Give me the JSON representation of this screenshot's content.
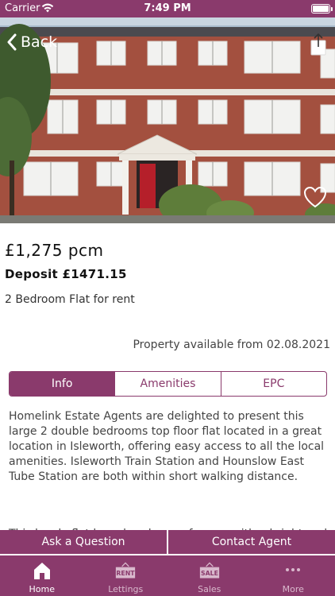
{
  "status_bar": {
    "carrier": "Carrier",
    "time": "7:49 PM"
  },
  "header": {
    "back_label": "Back"
  },
  "listing": {
    "price": "£1,275 pcm",
    "deposit": "Deposit £1471.15",
    "property_type": "2 Bedroom Flat for rent",
    "availability": "Property available from 02.08.2021"
  },
  "tabs": [
    {
      "label": "Info",
      "active": true
    },
    {
      "label": "Amenities",
      "active": false
    },
    {
      "label": "EPC",
      "active": false
    }
  ],
  "description": {
    "paragraph1": "Homelink Estate Agents are delighted to present this large 2 double bedrooms top floor flat located in a great location in Isleworth, offering easy access to all the local amenities. Isleworth Train Station and Hounslow East Tube Station are both within short walking distance.",
    "paragraph2": "This lovely flat has abundance of space with a bright and"
  },
  "actions": {
    "ask_question": "Ask a Question",
    "contact_agent": "Contact Agent"
  },
  "tab_bar": [
    {
      "label": "Home",
      "icon": "home-icon",
      "badge": "",
      "active": true
    },
    {
      "label": "Lettings",
      "icon": "rent-sign-icon",
      "badge": "RENT",
      "active": false
    },
    {
      "label": "Sales",
      "icon": "sale-sign-icon",
      "badge": "SALE",
      "active": false
    },
    {
      "label": "More",
      "icon": "more-dots-icon",
      "badge": "",
      "active": false
    }
  ],
  "colors": {
    "brand": "#8a3a6c",
    "brand_light": "#d9b9cd"
  }
}
